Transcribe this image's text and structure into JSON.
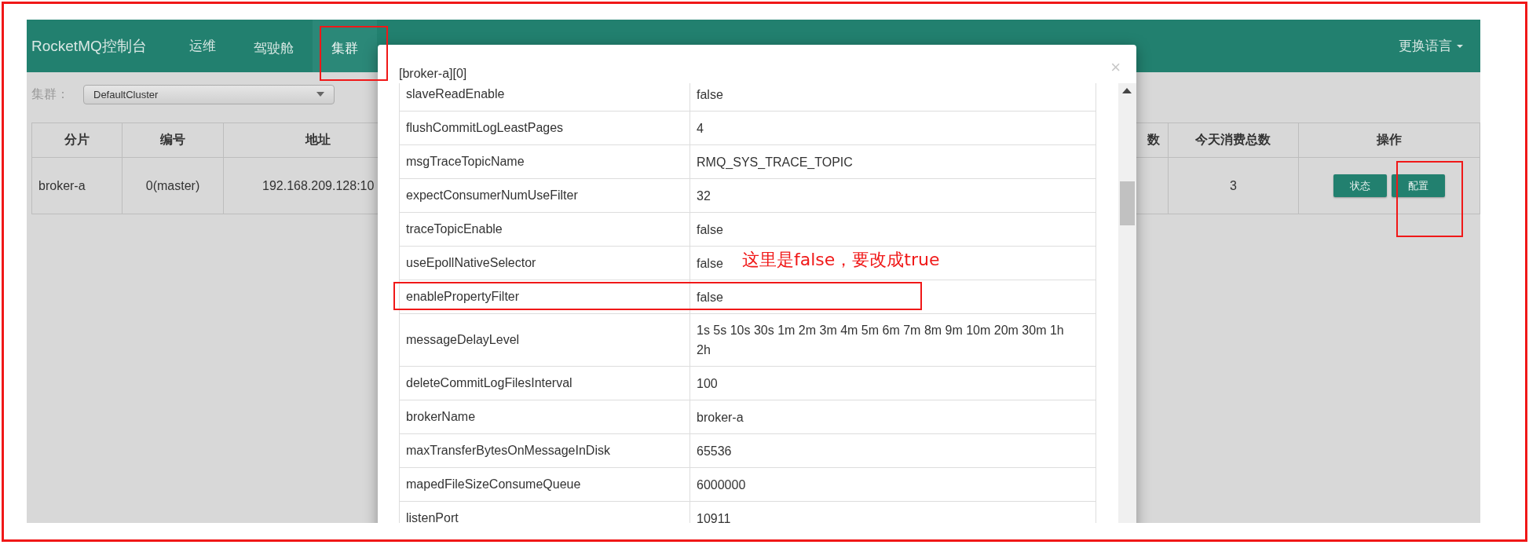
{
  "navbar": {
    "brand": "RocketMQ控制台",
    "items": [
      {
        "label": "运维",
        "selected": false
      },
      {
        "label": "驾驶舱",
        "selected": false
      },
      {
        "label": "集群",
        "selected": true
      }
    ],
    "language_menu": "更换语言"
  },
  "cluster_filter": {
    "label": "集群：",
    "value": "DefaultCluster"
  },
  "broker_table": {
    "columns": [
      "分片",
      "编号",
      "地址",
      "数",
      "今天消费总数",
      "操作"
    ],
    "rows": [
      {
        "cells": [
          "broker-a",
          "0(master)",
          "192.168.209.128:10",
          "",
          "3"
        ],
        "actions": [
          "状态",
          "配置"
        ]
      }
    ]
  },
  "modal": {
    "title": "[broker-a][0]",
    "close": "×",
    "rows": [
      {
        "key": "slaveReadEnable",
        "value": "false"
      },
      {
        "key": "flushCommitLogLeastPages",
        "value": "4"
      },
      {
        "key": "msgTraceTopicName",
        "value": "RMQ_SYS_TRACE_TOPIC"
      },
      {
        "key": "expectConsumerNumUseFilter",
        "value": "32"
      },
      {
        "key": "traceTopicEnable",
        "value": "false"
      },
      {
        "key": "useEpollNativeSelector",
        "value": "false"
      },
      {
        "key": "enablePropertyFilter",
        "value": "false"
      },
      {
        "key": "messageDelayLevel",
        "value": "1s 5s 10s 30s 1m 2m 3m 4m 5m 6m 7m 8m 9m 10m 20m 30m 1h 2h"
      },
      {
        "key": "deleteCommitLogFilesInterval",
        "value": "100"
      },
      {
        "key": "brokerName",
        "value": "broker-a"
      },
      {
        "key": "maxTransferBytesOnMessageInDisk",
        "value": "65536"
      },
      {
        "key": "mapedFileSizeConsumeQueue",
        "value": "6000000"
      },
      {
        "key": "listenPort",
        "value": "10911"
      }
    ]
  },
  "annotation": {
    "note": "这里是false，要改成true"
  }
}
